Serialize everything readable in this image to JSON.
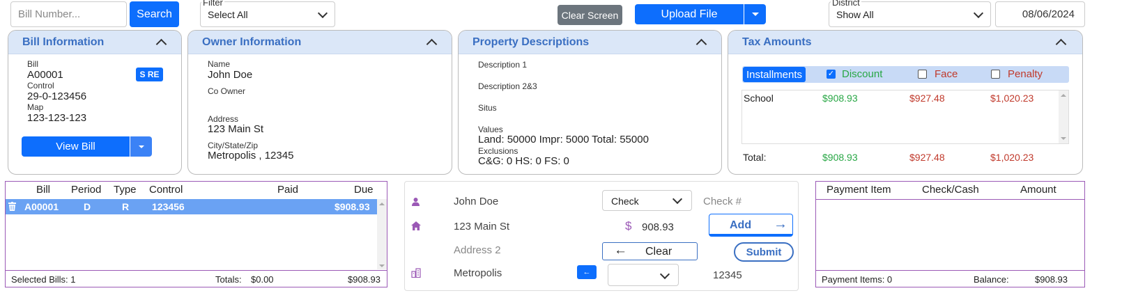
{
  "topbar": {
    "bill_number_placeholder": "Bill Number...",
    "search_label": "Search",
    "filter_label": "Filter",
    "filter_value": "Select All",
    "clear_screen_label": "Clear Screen",
    "upload_file_label": "Upload File",
    "district_label": "District",
    "district_value": "Show All",
    "date_value": "08/06/2024"
  },
  "bill_info": {
    "title": "Bill Information",
    "bill_label": "Bill",
    "bill_value": "A00001",
    "badge": "S RE",
    "control_label": "Control",
    "control_value": "29-0-123456",
    "map_label": "Map",
    "map_value": "123-123-123",
    "view_bill_label": "View Bill"
  },
  "owner_info": {
    "title": "Owner Information",
    "name_label": "Name",
    "name_value": "John Doe",
    "co_owner_label": "Co Owner",
    "address_label": "Address",
    "address_value": "123 Main St",
    "csz_label": "City/State/Zip",
    "csz_value": "Metropolis , 12345"
  },
  "property": {
    "title": "Property Descriptions",
    "desc1_label": "Description 1",
    "desc23_label": "Description 2&3",
    "situs_label": "Situs",
    "values_label": "Values",
    "values_value": "Land: 50000 Impr: 5000 Total: 55000",
    "exclusions_label": "Exclusions",
    "exclusions_value": "C&G: 0 HS: 0 FS: 0"
  },
  "tax": {
    "title": "Tax Amounts",
    "installments_label": "Installments",
    "discount_label": "Discount",
    "face_label": "Face",
    "penalty_label": "Penalty",
    "row_label": "School",
    "row_discount": "$908.93",
    "row_face": "$927.48",
    "row_penalty": "$1,020.23",
    "total_label": "Total:",
    "total_discount": "$908.93",
    "total_face": "$927.48",
    "total_penalty": "$1,020.23",
    "colors": {
      "green": "#28a745",
      "red": "#c0392b"
    }
  },
  "bills_table": {
    "headers": {
      "bill": "Bill",
      "period": "Period",
      "type": "Type",
      "control": "Control",
      "paid": "Paid",
      "due": "Due"
    },
    "row": {
      "bill": "A00001",
      "period": "D",
      "type": "R",
      "control": "123456",
      "paid": "",
      "due": "$908.93"
    },
    "footer_selected": "Selected Bills: 1",
    "footer_totals_label": "Totals:",
    "footer_paid": "$0.00",
    "footer_due": "$908.93"
  },
  "payment_form": {
    "name": "John Doe",
    "address1": "123 Main St",
    "address2_placeholder": "Address 2",
    "city": "Metropolis",
    "zip": "12345",
    "method": "Check",
    "check_placeholder": "Check #",
    "amount": "908.93",
    "currency_symbol": "$",
    "add_label": "Add",
    "clear_label": "Clear",
    "submit_label": "Submit"
  },
  "payment_items": {
    "headers": {
      "item": "Payment Item",
      "check_cash": "Check/Cash",
      "amount": "Amount"
    },
    "footer_items": "Payment Items: 0",
    "footer_balance_label": "Balance:",
    "footer_balance": "$908.93"
  }
}
